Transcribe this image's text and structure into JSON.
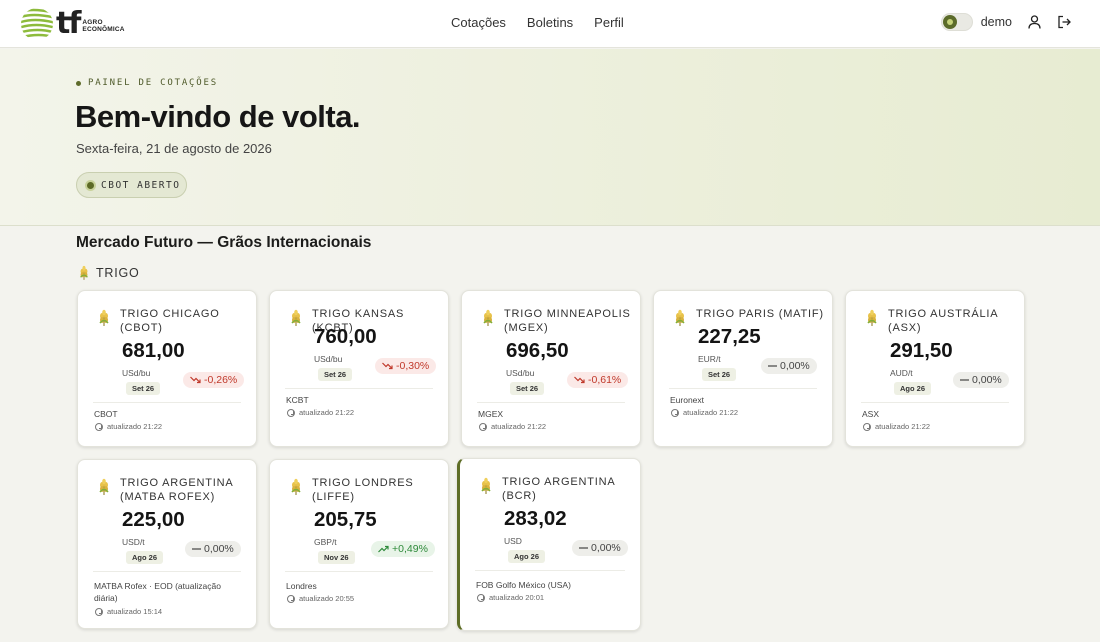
{
  "brand": {
    "mark": "tf",
    "line1": "AGRO",
    "line2": "ECONÔMICA"
  },
  "nav": [
    {
      "label": "Cotações"
    },
    {
      "label": "Boletins"
    },
    {
      "label": "Perfil"
    }
  ],
  "user": {
    "name": "demo"
  },
  "hero": {
    "eyebrow": "PAINEL DE COTAÇÕES",
    "title": "Bem-vindo de volta.",
    "date": "Sexta-feira, 21 de agosto de 2026",
    "market_status": "CBOT ABERTO"
  },
  "section": {
    "title": "Mercado Futuro — Grãos Internacionais",
    "group": "TRIGO"
  },
  "colors": {
    "accent": "#5e6d26",
    "down": "#c0392b",
    "up": "#2e8a3a"
  },
  "cards": [
    {
      "title": "TRIGO CHICAGO (CBOT)",
      "price": "681,00",
      "unit": "USd/bu",
      "month": "Set 26",
      "change": "-0,26%",
      "trend": "down",
      "exchange": "CBOT",
      "updated": "atualizado 21:22"
    },
    {
      "title": "TRIGO KANSAS (KCBT)",
      "price": "760,00",
      "unit": "USd/bu",
      "month": "Set 26",
      "change": "-0,30%",
      "trend": "down",
      "exchange": "KCBT",
      "updated": "atualizado 21:22"
    },
    {
      "title": "TRIGO MINNEAPOLIS (MGEX)",
      "price": "696,50",
      "unit": "USd/bu",
      "month": "Set 26",
      "change": "-0,61%",
      "trend": "down",
      "exchange": "MGEX",
      "updated": "atualizado 21:22"
    },
    {
      "title": "TRIGO PARIS (MATIF)",
      "price": "227,25",
      "unit": "EUR/t",
      "month": "Set 26",
      "change": "0,00%",
      "trend": "flat",
      "exchange": "Euronext",
      "updated": "atualizado 21:22"
    },
    {
      "title": "TRIGO AUSTRÁLIA (ASX)",
      "price": "291,50",
      "unit": "AUD/t",
      "month": "Ago 26",
      "change": "0,00%",
      "trend": "flat",
      "exchange": "ASX",
      "updated": "atualizado 21:22"
    },
    {
      "title": "TRIGO ARGENTINA (MATBA ROFEX)",
      "price": "225,00",
      "unit": "USD/t",
      "month": "Ago 26",
      "change": "0,00%",
      "trend": "flat",
      "exchange": "MATBA Rofex · EOD (atualização diária)",
      "updated": "atualizado 15:14"
    },
    {
      "title": "TRIGO LONDRES (LIFFE)",
      "price": "205,75",
      "unit": "GBP/t",
      "month": "Nov 26",
      "change": "+0,49%",
      "trend": "up",
      "exchange": "Londres",
      "updated": "atualizado 20:55"
    },
    {
      "title": "TRIGO ARGENTINA (BCR)",
      "price": "283,02",
      "unit": "USD",
      "month": "Ago 26",
      "change": "0,00%",
      "trend": "flat",
      "exchange": "FOB Golfo México (USA)",
      "updated": "atualizado 20:01"
    }
  ]
}
